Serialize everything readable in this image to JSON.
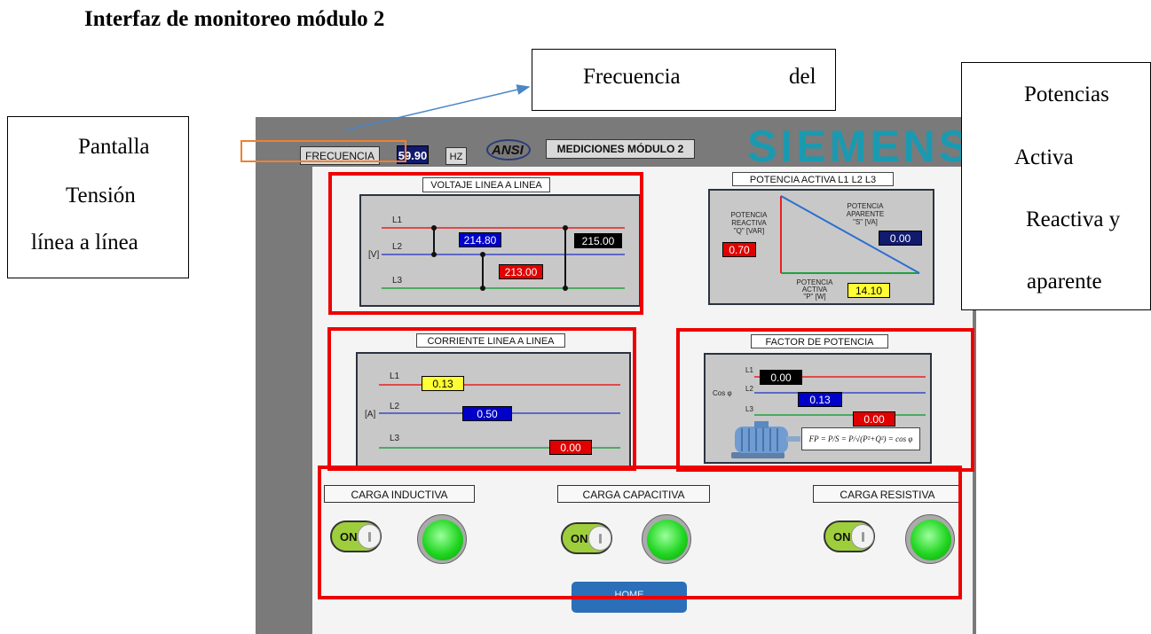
{
  "doc_title": "Interfaz de monitoreo módulo 2",
  "callouts": {
    "frecuencia": [
      "Frecuencia",
      "del"
    ],
    "pantalla": [
      "Pantalla",
      "Tensión",
      "línea a línea"
    ],
    "potencias": [
      "Potencias",
      "Activa",
      "Reactiva y",
      "aparente"
    ]
  },
  "hmi": {
    "frecuencia_label": "FRECUENCIA",
    "frecuencia_value": "59.90",
    "hz_label": "HZ",
    "ansi_logo": "ANSI",
    "title": "MEDICIONES MÓDULO 2",
    "brand": "SIEMENS",
    "voltaje": {
      "title": "VOLTAJE LINEA A LINEA",
      "lines": [
        "L1",
        "L2",
        "L3"
      ],
      "unit": "[V]",
      "v12": "214.80",
      "v13": "215.00",
      "v23": "213.00"
    },
    "potencia": {
      "title": "POTENCIA ACTIVA L1 L2 L3",
      "reactiva_label": [
        "POTENCIA",
        "REACTIVA",
        "\"Q\" [VAR]"
      ],
      "reactiva_value": "0.70",
      "aparente_label": [
        "POTENCIA",
        "APARENTE",
        "\"S\" [VA]"
      ],
      "aparente_value": "0.00",
      "activa_label": [
        "POTENCIA",
        "ACTIVA",
        "\"P\" [W]"
      ],
      "activa_value": "14.10"
    },
    "corriente": {
      "title": "CORRIENTE LINEA A LINEA",
      "lines": [
        "L1",
        "L2",
        "L3"
      ],
      "unit": "[A]",
      "i1": "0.13",
      "i2": "0.50",
      "i3": "0.00"
    },
    "factor": {
      "title": "FACTOR DE POTENCIA",
      "lines": [
        "L1",
        "L2",
        "L3"
      ],
      "cos_label": "Cos φ",
      "f1": "0.00",
      "f2": "0.13",
      "f3": "0.00",
      "formula": "FP = P/S = P/√(P²+Q²) = cos φ"
    },
    "cargas": [
      {
        "label": "CARGA INDUCTIVA",
        "toggle": "ON"
      },
      {
        "label": "CARGA CAPACITIVA",
        "toggle": "ON"
      },
      {
        "label": "CARGA RESISTIVA",
        "toggle": "ON"
      }
    ],
    "home_button": "HOME"
  },
  "colors": {
    "highlight_frame": "#ee0000",
    "callout_arrow": "#4a86c8",
    "freq_highlight": "#f08030",
    "brand": "#1a9ab0"
  }
}
